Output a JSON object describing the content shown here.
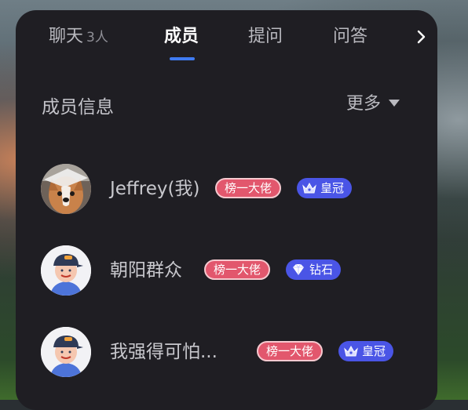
{
  "tabs": [
    {
      "label": "聊天",
      "count": "3人"
    },
    {
      "label": "成员"
    },
    {
      "label": "提问"
    },
    {
      "label": "问答"
    }
  ],
  "section": {
    "title": "成员信息",
    "more_label": "更多"
  },
  "members": [
    {
      "name": "Jeffrey(我)",
      "rank_badge": "榜一大佬",
      "level_badge": "皇冠",
      "level_icon": "crown-icon",
      "avatar": "corgi-photo"
    },
    {
      "name": "朝阳群众",
      "rank_badge": "榜一大佬",
      "level_badge": "钻石",
      "level_icon": "diamond-icon",
      "avatar": "cartoon-boy-cap"
    },
    {
      "name": "我强得可怕...",
      "rank_badge": "榜一大佬",
      "level_badge": "皇冠",
      "level_icon": "crown-icon",
      "avatar": "cartoon-boy-cap"
    }
  ],
  "colors": {
    "panel": "#1f1e23",
    "accent": "#3f7bf2",
    "rank_badge": "#e2576d",
    "level_badge": "#4a55e6"
  }
}
